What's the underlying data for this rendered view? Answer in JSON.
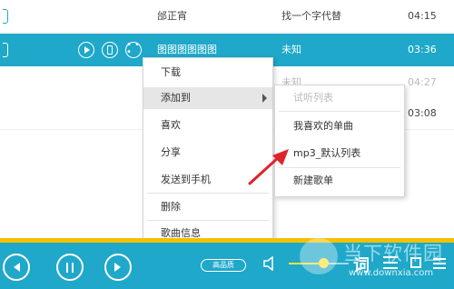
{
  "track_list": [
    {
      "title": "邰正宵",
      "artist": "找一个字代替",
      "duration": "04:15"
    },
    {
      "title": "图图图图图图",
      "artist": "未知",
      "duration": "03:36"
    },
    {
      "title": "",
      "artist": "未知",
      "duration": "04:27"
    },
    {
      "title": "",
      "artist": "",
      "duration": "03:08"
    }
  ],
  "context_menu": {
    "items": [
      "下载",
      "添加到",
      "喜欢",
      "分享",
      "发送到手机",
      "删除",
      "歌曲信息"
    ]
  },
  "add_to_submenu": {
    "items": [
      "试听列表",
      "我喜欢的单曲",
      "mp3_默认列表",
      "新建歌单"
    ]
  },
  "player_bar": {
    "quality_label": "高品质"
  },
  "watermark": {
    "title": "当下软件园",
    "url": "www.downxia.com"
  },
  "colors": {
    "accent": "#1fa8c9",
    "progress": "#f5c000",
    "annotation_arrow": "#e0232b"
  },
  "volume_level": 0.5
}
